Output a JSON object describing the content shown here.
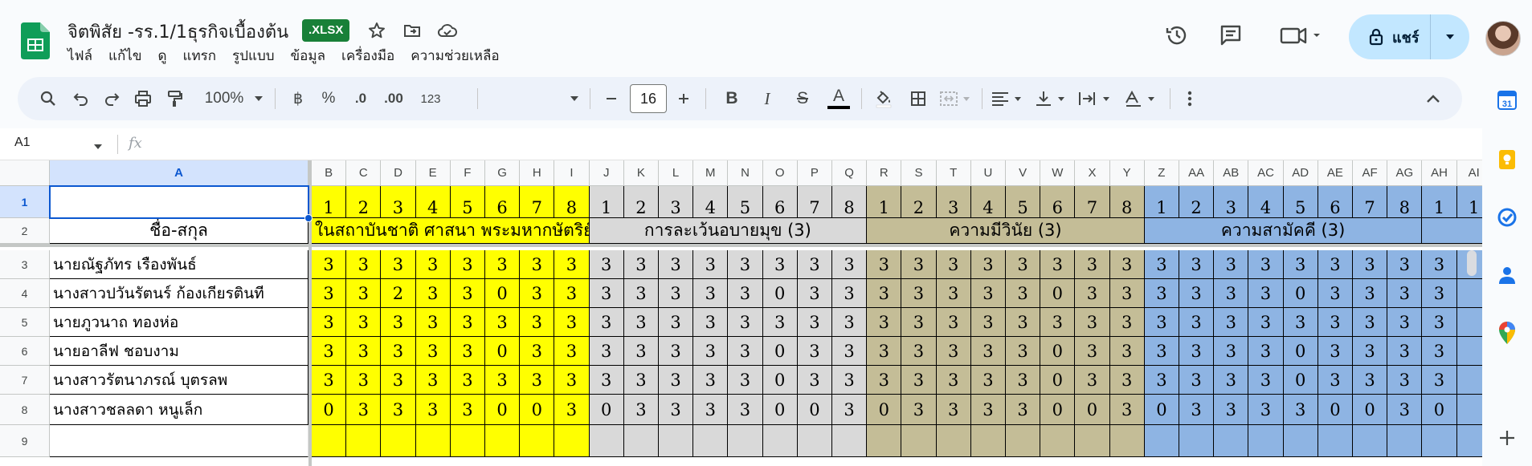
{
  "doc": {
    "title": "จิตพิสัย -รร.1/1ธุรกิจเบื้องต้น",
    "badge": ".XLSX"
  },
  "menu": [
    "ไฟล์",
    "แก้ไข",
    "ดู",
    "แทรก",
    "รูปแบบ",
    "ข้อมูล",
    "เครื่องมือ",
    "ความช่วยเหลือ"
  ],
  "share": {
    "label": "แชร์"
  },
  "toolbar": {
    "zoom": "100%",
    "currency": "฿",
    "percent": "%",
    "dec_minus": ".0",
    "dec_plus": ".00",
    "number_format": "123",
    "font_size": "16",
    "bold": "B",
    "italic": "I",
    "strike": "S",
    "text_color": "A"
  },
  "formula_bar": {
    "name_box": "A1",
    "fx": "fx"
  },
  "colors": {
    "yellow": "#ffff00",
    "gray": "#d9d9d9",
    "khaki": "#c4bd97",
    "blue": "#8eb4e3",
    "selection": "#0b57d0",
    "brand_green": "#188038"
  },
  "sheet": {
    "column_letters": [
      "A",
      "B",
      "C",
      "D",
      "E",
      "F",
      "G",
      "H",
      "I",
      "J",
      "K",
      "L",
      "M",
      "N",
      "O",
      "P",
      "Q",
      "R",
      "S",
      "T",
      "U",
      "V",
      "W",
      "X",
      "Y",
      "Z",
      "AA",
      "AB",
      "AC",
      "AD",
      "AE",
      "AF",
      "AG",
      "AH",
      "AI"
    ],
    "row_numbers": [
      "1",
      "2",
      "3",
      "4",
      "5",
      "6",
      "7",
      "8",
      "9"
    ],
    "number_row": [
      "1",
      "2",
      "3",
      "4",
      "5",
      "6",
      "7",
      "8",
      "1",
      "2",
      "3",
      "4",
      "5",
      "6",
      "7",
      "8",
      "1",
      "2",
      "3",
      "4",
      "5",
      "6",
      "7",
      "8",
      "1",
      "2",
      "3",
      "4",
      "5",
      "6",
      "7",
      "8",
      "1",
      "1"
    ],
    "name_header": "ชื่อ-สกุล",
    "groups": [
      {
        "label": "ในสถาบันชาติ ศาสนา พระมหากษัตริย์",
        "color": "yellow"
      },
      {
        "label": "การละเว้นอบายมุข (3)",
        "color": "gray"
      },
      {
        "label": "ความมีวินัย (3)",
        "color": "khaki"
      },
      {
        "label": "ความสามัคคี (3)",
        "color": "blue"
      }
    ],
    "students": [
      {
        "name": "นายณัฐภัทร  เรืองพันธ์",
        "scores": [
          "3",
          "3",
          "3",
          "3",
          "3",
          "3",
          "3",
          "3",
          "3",
          "3",
          "3",
          "3",
          "3",
          "3",
          "3",
          "3",
          "3",
          "3",
          "3",
          "3",
          "3",
          "3",
          "3",
          "3",
          "3",
          "3",
          "3",
          "3",
          "3",
          "3",
          "3",
          "3",
          "3"
        ]
      },
      {
        "name": "นางสาวปวันรัตนร์   ก้องเกียรตินที",
        "scores": [
          "3",
          "3",
          "2",
          "3",
          "3",
          "0",
          "3",
          "3",
          "3",
          "3",
          "3",
          "3",
          "3",
          "0",
          "3",
          "3",
          "3",
          "3",
          "3",
          "3",
          "3",
          "0",
          "3",
          "3",
          "3",
          "3",
          "3",
          "3",
          "0",
          "3",
          "3",
          "3",
          "3"
        ]
      },
      {
        "name": "นายภูวนาถ ทองห่อ",
        "scores": [
          "3",
          "3",
          "3",
          "3",
          "3",
          "3",
          "3",
          "3",
          "3",
          "3",
          "3",
          "3",
          "3",
          "3",
          "3",
          "3",
          "3",
          "3",
          "3",
          "3",
          "3",
          "3",
          "3",
          "3",
          "3",
          "3",
          "3",
          "3",
          "3",
          "3",
          "3",
          "3",
          "3"
        ]
      },
      {
        "name": "นายอาลีฟ ชอบงาม",
        "scores": [
          "3",
          "3",
          "3",
          "3",
          "3",
          "0",
          "3",
          "3",
          "3",
          "3",
          "3",
          "3",
          "3",
          "0",
          "3",
          "3",
          "3",
          "3",
          "3",
          "3",
          "3",
          "0",
          "3",
          "3",
          "3",
          "3",
          "3",
          "3",
          "0",
          "3",
          "3",
          "3",
          "3"
        ]
      },
      {
        "name": "นางสาวรัตนาภรณ์  บุตรลพ",
        "scores": [
          "3",
          "3",
          "3",
          "3",
          "3",
          "3",
          "3",
          "3",
          "3",
          "3",
          "3",
          "3",
          "3",
          "0",
          "3",
          "3",
          "3",
          "3",
          "3",
          "3",
          "3",
          "0",
          "3",
          "3",
          "3",
          "3",
          "3",
          "3",
          "0",
          "3",
          "3",
          "3",
          "3"
        ]
      },
      {
        "name": "นางสาวชลลดา  หนูเล็ก",
        "scores": [
          "0",
          "3",
          "3",
          "3",
          "3",
          "0",
          "0",
          "3",
          "0",
          "3",
          "3",
          "3",
          "3",
          "0",
          "0",
          "3",
          "0",
          "3",
          "3",
          "3",
          "3",
          "0",
          "0",
          "3",
          "0",
          "3",
          "3",
          "3",
          "3",
          "0",
          "0",
          "3",
          "0"
        ]
      }
    ]
  }
}
